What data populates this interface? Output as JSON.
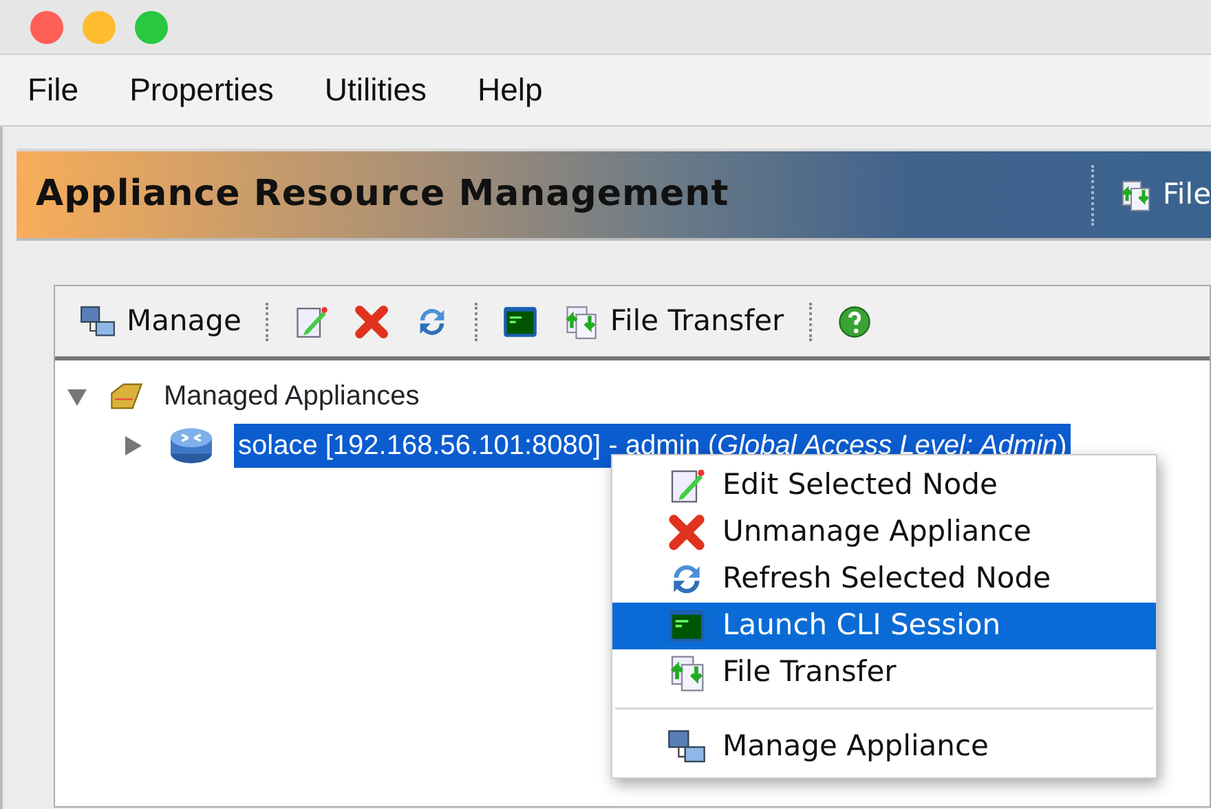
{
  "window": {
    "title_buttons": [
      {
        "color": "#fe5f57"
      },
      {
        "color": "#febc2e"
      },
      {
        "color": "#28c840"
      }
    ]
  },
  "menu_bar": [
    "File",
    "Properties",
    "Utilities",
    "Help"
  ],
  "banner": {
    "title": "Appliance Resource Management",
    "tools": [
      {
        "kind": "transfer",
        "label": "File"
      }
    ]
  },
  "toolbar": [
    {
      "kind": "network",
      "label": "Manage"
    },
    {
      "kind": "separator"
    },
    {
      "kind": "edit"
    },
    {
      "kind": "delete"
    },
    {
      "kind": "refresh"
    },
    {
      "kind": "separator"
    },
    {
      "kind": "terminal"
    },
    {
      "kind": "transfer",
      "label": "File Transfer"
    },
    {
      "kind": "separator"
    },
    {
      "kind": "help"
    }
  ],
  "tree": [
    {
      "kind": "folder",
      "label": "Managed Appliances",
      "expanded": true,
      "selected": false,
      "children": [
        {
          "kind": "router",
          "label": "solace [192.168.56.101:8080] - admin (*Global Access Level: Admin*)",
          "expanded": false,
          "selected": true
        }
      ]
    }
  ],
  "context_menu": [
    {
      "kind": "edit",
      "label": "Edit Selected Node",
      "selected": false
    },
    {
      "kind": "delete",
      "label": "Unmanage Appliance",
      "selected": false
    },
    {
      "kind": "refresh",
      "label": "Refresh Selected Node",
      "selected": false
    },
    {
      "kind": "terminal",
      "label": "Launch CLI Session",
      "selected": true
    },
    {
      "kind": "transfer",
      "label": "File Transfer",
      "selected": false
    },
    {
      "kind": "separator"
    },
    {
      "kind": "network",
      "label": "Manage Appliance",
      "selected": false
    }
  ]
}
